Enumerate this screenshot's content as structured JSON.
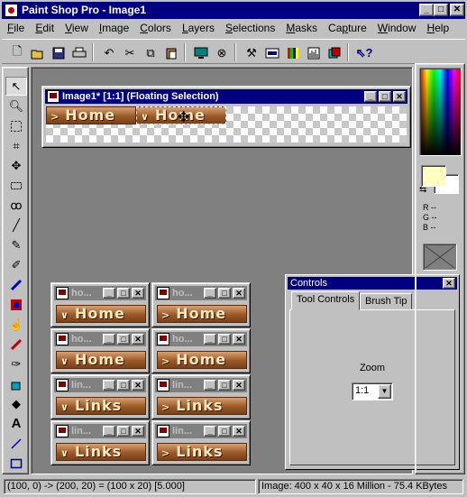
{
  "window": {
    "title": "Paint Shop Pro - Image1",
    "minimize": "_",
    "maximize": "□",
    "close": "✕"
  },
  "menu": [
    "File",
    "Edit",
    "View",
    "Image",
    "Colors",
    "Layers",
    "Selections",
    "Masks",
    "Capture",
    "Window",
    "Help"
  ],
  "menu_accel": [
    "F",
    "E",
    "V",
    "I",
    "C",
    "L",
    "S",
    "M",
    "p",
    "W",
    "H"
  ],
  "toolbar": [
    "new-icon",
    "open-icon",
    "save-icon",
    "print-icon",
    "undo-icon",
    "cut-icon",
    "copy-icon",
    "paste-icon",
    "browse-icon",
    "capture-icon",
    "toggle-tool-palette-icon",
    "toggle-style-bar-icon",
    "toggle-color-palette-icon",
    "histogram-icon",
    "layer-palette-icon",
    "help-icon"
  ],
  "image_window": {
    "title": "Image1* [1:1] (Floating Selection)",
    "buttons": [
      "Home",
      "Home"
    ]
  },
  "thumb_windows": [
    {
      "title": "ho...",
      "label": "Home"
    },
    {
      "title": "ho...",
      "label": "Home"
    },
    {
      "title": "ho...",
      "label": "Home"
    },
    {
      "title": "ho...",
      "label": "Home"
    },
    {
      "title": "lin...",
      "label": "Links"
    },
    {
      "title": "lin...",
      "label": "Links"
    },
    {
      "title": "lin...",
      "label": "Links"
    },
    {
      "title": "lin...",
      "label": "Links"
    }
  ],
  "controls": {
    "title": "Controls",
    "close": "✕",
    "tabs": [
      "Tool Controls",
      "Brush Tip"
    ],
    "zoom_label": "Zoom",
    "zoom_value": "1:1"
  },
  "color_panel": {
    "r": "R --",
    "g": "G --",
    "b": "B --",
    "foreground": "#ffffc0",
    "background": "#ffffff"
  },
  "status": {
    "coords": "(100, 0) -> (200, 20) = (100 x 20) [5.000]",
    "image": "Image:  400 x 40 x 16 Million - 75.4 KBytes"
  }
}
